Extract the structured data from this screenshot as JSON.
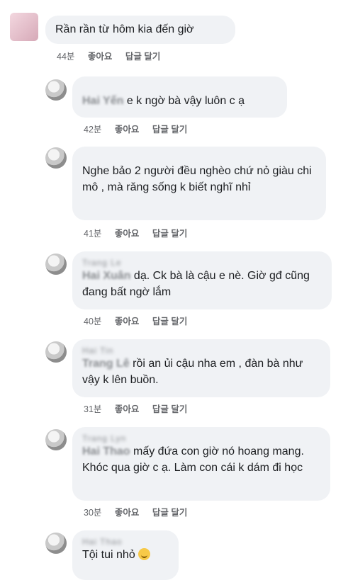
{
  "comments": [
    {
      "name": "",
      "tag": "",
      "text": "Rần rần từ hôm kia đến giờ",
      "time": "44분",
      "like": "좋아요",
      "reply": "답글 달기"
    },
    {
      "name": "",
      "tag": "Hai Yến",
      "text": " e k ngờ bà vậy luôn c ạ",
      "time": "42분",
      "like": "좋아요",
      "reply": "답글 달기"
    },
    {
      "name": "",
      "tag": "",
      "text": "Nghe bảo 2 người đều nghèo chứ nỏ giàu chi mô , mà răng sống k biết nghĩ nhỉ",
      "time": "41분",
      "like": "좋아요",
      "reply": "답글 달기"
    },
    {
      "name": "Trang Le",
      "tag": "Hai Xuân",
      "text": " dạ. Ck bà là cậu e nè. Giờ gđ cũng đang bất ngờ lắm",
      "time": "40분",
      "like": "좋아요",
      "reply": "답글 달기"
    },
    {
      "name": "Hai Tin",
      "tag": "Trang Lê",
      "text": " rồi an ủi cậu nha em , đàn bà như vậy k lên buồn.",
      "time": "31분",
      "like": "좋아요",
      "reply": "답글 달기"
    },
    {
      "name": "Trang Lyn",
      "tag": "Hai Thao",
      "text": " mấy đứa con giờ nó hoang mang. Khóc qua giờ c ạ. Làm con cái k dám đi học",
      "time": "30분",
      "like": "좋아요",
      "reply": "답글 달기"
    },
    {
      "name": "Hai Thao",
      "tag": "",
      "text": "Tội tui nhỏ ",
      "emoji": "grinning-sweat",
      "time": "",
      "like": "",
      "reply": ""
    }
  ]
}
